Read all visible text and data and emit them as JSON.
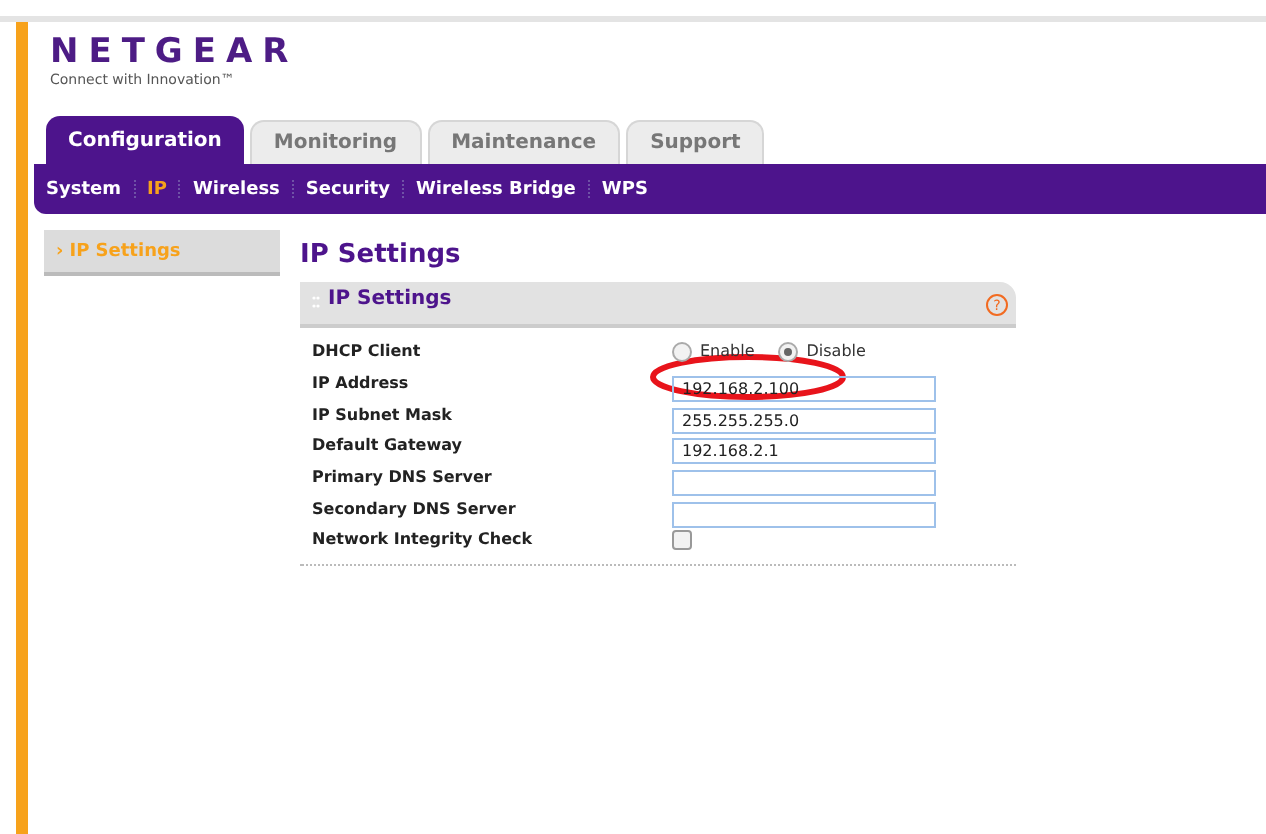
{
  "logo": {
    "brand": "NETGEAR",
    "tagline": "Connect with Innovation™"
  },
  "tabs": [
    {
      "label": "Configuration",
      "selected": true
    },
    {
      "label": "Monitoring",
      "selected": false
    },
    {
      "label": "Maintenance",
      "selected": false
    },
    {
      "label": "Support",
      "selected": false
    }
  ],
  "subnav": [
    {
      "label": "System",
      "selected": false
    },
    {
      "label": "IP",
      "selected": true
    },
    {
      "label": "Wireless",
      "selected": false
    },
    {
      "label": "Security",
      "selected": false
    },
    {
      "label": "Wireless Bridge",
      "selected": false
    },
    {
      "label": "WPS",
      "selected": false
    }
  ],
  "sidebar": {
    "items": [
      {
        "arrow": "›",
        "label": "IP Settings",
        "selected": true
      }
    ]
  },
  "page_title": "IP Settings",
  "panel": {
    "title": "IP Settings",
    "help": "?",
    "rows": [
      {
        "kind": "radio",
        "label": "DHCP Client",
        "options": [
          {
            "label": "Enable",
            "selected": false
          },
          {
            "label": "Disable",
            "selected": true
          }
        ]
      },
      {
        "kind": "text",
        "label": "IP Address",
        "value": "192.168.2.100",
        "circled": true
      },
      {
        "kind": "text",
        "label": "IP Subnet Mask",
        "value": "255.255.255.0"
      },
      {
        "kind": "text",
        "label": "Default Gateway",
        "value": "192.168.2.1"
      },
      {
        "kind": "text",
        "label": "Primary DNS Server",
        "value": ""
      },
      {
        "kind": "text",
        "label": "Secondary DNS Server",
        "value": ""
      },
      {
        "kind": "checkbox",
        "label": "Network Integrity Check",
        "checked": false
      }
    ]
  }
}
